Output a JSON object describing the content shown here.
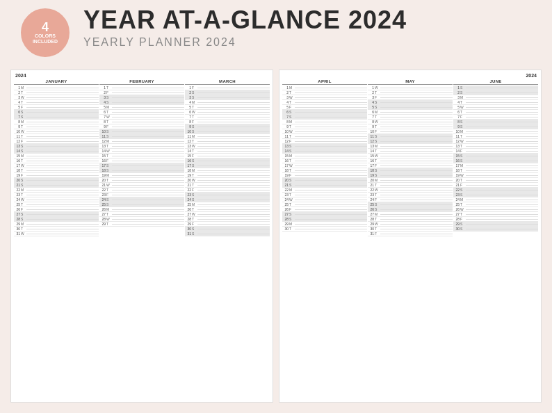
{
  "badge": {
    "number": "4",
    "line1": "COLORS",
    "line2": "INCLUDED"
  },
  "title": {
    "main": "YEAR AT-A-GLANCE 2024",
    "sub": "YEARLY PLANNER 2024"
  },
  "planners": [
    {
      "year": "2024",
      "year_right": "",
      "months": [
        {
          "name": "JANUARY",
          "days": [
            {
              "n": 1,
              "d": "M"
            },
            {
              "n": 2,
              "d": "T"
            },
            {
              "n": 3,
              "d": "W"
            },
            {
              "n": 4,
              "d": "T"
            },
            {
              "n": 5,
              "d": "F"
            },
            {
              "n": 6,
              "d": "S"
            },
            {
              "n": 7,
              "d": "S"
            },
            {
              "n": 8,
              "d": "M"
            },
            {
              "n": 9,
              "d": "T"
            },
            {
              "n": 10,
              "d": "W"
            },
            {
              "n": 11,
              "d": "T"
            },
            {
              "n": 12,
              "d": "F"
            },
            {
              "n": 13,
              "d": "S"
            },
            {
              "n": 14,
              "d": "S"
            },
            {
              "n": 15,
              "d": "M"
            },
            {
              "n": 16,
              "d": "T"
            },
            {
              "n": 17,
              "d": "W"
            },
            {
              "n": 18,
              "d": "T"
            },
            {
              "n": 19,
              "d": "F"
            },
            {
              "n": 20,
              "d": "S"
            },
            {
              "n": 21,
              "d": "S"
            },
            {
              "n": 22,
              "d": "M"
            },
            {
              "n": 23,
              "d": "T"
            },
            {
              "n": 24,
              "d": "W"
            },
            {
              "n": 25,
              "d": "T"
            },
            {
              "n": 26,
              "d": "F"
            },
            {
              "n": 27,
              "d": "S"
            },
            {
              "n": 28,
              "d": "S"
            },
            {
              "n": 29,
              "d": "M"
            },
            {
              "n": 30,
              "d": "T"
            },
            {
              "n": 31,
              "d": "W"
            }
          ]
        },
        {
          "name": "FEBRUARY",
          "days": [
            {
              "n": 1,
              "d": "T"
            },
            {
              "n": 2,
              "d": "F"
            },
            {
              "n": 3,
              "d": "S"
            },
            {
              "n": 4,
              "d": "S"
            },
            {
              "n": 5,
              "d": "M"
            },
            {
              "n": 6,
              "d": "T"
            },
            {
              "n": 7,
              "d": "W"
            },
            {
              "n": 8,
              "d": "T"
            },
            {
              "n": 9,
              "d": "F"
            },
            {
              "n": 10,
              "d": "S"
            },
            {
              "n": 11,
              "d": "S"
            },
            {
              "n": 12,
              "d": "M"
            },
            {
              "n": 13,
              "d": "T"
            },
            {
              "n": 14,
              "d": "W"
            },
            {
              "n": 15,
              "d": "T"
            },
            {
              "n": 16,
              "d": "F"
            },
            {
              "n": 17,
              "d": "S"
            },
            {
              "n": 18,
              "d": "S"
            },
            {
              "n": 19,
              "d": "M"
            },
            {
              "n": 20,
              "d": "T"
            },
            {
              "n": 21,
              "d": "W"
            },
            {
              "n": 22,
              "d": "T"
            },
            {
              "n": 23,
              "d": "F"
            },
            {
              "n": 24,
              "d": "S"
            },
            {
              "n": 25,
              "d": "S"
            },
            {
              "n": 26,
              "d": "M"
            },
            {
              "n": 27,
              "d": "T"
            },
            {
              "n": 28,
              "d": "W"
            },
            {
              "n": 29,
              "d": "T"
            }
          ]
        },
        {
          "name": "MARCH",
          "days": [
            {
              "n": 1,
              "d": "F"
            },
            {
              "n": 2,
              "d": "S"
            },
            {
              "n": 3,
              "d": "S"
            },
            {
              "n": 4,
              "d": "M"
            },
            {
              "n": 5,
              "d": "T"
            },
            {
              "n": 6,
              "d": "W"
            },
            {
              "n": 7,
              "d": "T"
            },
            {
              "n": 8,
              "d": "F"
            },
            {
              "n": 9,
              "d": "S"
            },
            {
              "n": 10,
              "d": "S"
            },
            {
              "n": 11,
              "d": "M"
            },
            {
              "n": 12,
              "d": "T"
            },
            {
              "n": 13,
              "d": "W"
            },
            {
              "n": 14,
              "d": "T"
            },
            {
              "n": 15,
              "d": "F"
            },
            {
              "n": 16,
              "d": "S"
            },
            {
              "n": 17,
              "d": "S"
            },
            {
              "n": 18,
              "d": "M"
            },
            {
              "n": 19,
              "d": "T"
            },
            {
              "n": 20,
              "d": "W"
            },
            {
              "n": 21,
              "d": "T"
            },
            {
              "n": 22,
              "d": "F"
            },
            {
              "n": 23,
              "d": "S"
            },
            {
              "n": 24,
              "d": "S"
            },
            {
              "n": 25,
              "d": "M"
            },
            {
              "n": 26,
              "d": "T"
            },
            {
              "n": 27,
              "d": "W"
            },
            {
              "n": 28,
              "d": "T"
            },
            {
              "n": 29,
              "d": "F"
            },
            {
              "n": 30,
              "d": "S"
            },
            {
              "n": 31,
              "d": "S"
            }
          ]
        }
      ]
    },
    {
      "year": "",
      "year_right": "2024",
      "months": [
        {
          "name": "APRIL",
          "days": [
            {
              "n": 1,
              "d": "M"
            },
            {
              "n": 2,
              "d": "T"
            },
            {
              "n": 3,
              "d": "W"
            },
            {
              "n": 4,
              "d": "T"
            },
            {
              "n": 5,
              "d": "F"
            },
            {
              "n": 6,
              "d": "S"
            },
            {
              "n": 7,
              "d": "S"
            },
            {
              "n": 8,
              "d": "M"
            },
            {
              "n": 9,
              "d": "T"
            },
            {
              "n": 10,
              "d": "W"
            },
            {
              "n": 11,
              "d": "T"
            },
            {
              "n": 12,
              "d": "F"
            },
            {
              "n": 13,
              "d": "S"
            },
            {
              "n": 14,
              "d": "S"
            },
            {
              "n": 15,
              "d": "M"
            },
            {
              "n": 16,
              "d": "T"
            },
            {
              "n": 17,
              "d": "W"
            },
            {
              "n": 18,
              "d": "T"
            },
            {
              "n": 19,
              "d": "F"
            },
            {
              "n": 20,
              "d": "S"
            },
            {
              "n": 21,
              "d": "S"
            },
            {
              "n": 22,
              "d": "M"
            },
            {
              "n": 23,
              "d": "T"
            },
            {
              "n": 24,
              "d": "W"
            },
            {
              "n": 25,
              "d": "T"
            },
            {
              "n": 26,
              "d": "F"
            },
            {
              "n": 27,
              "d": "S"
            },
            {
              "n": 28,
              "d": "S"
            },
            {
              "n": 29,
              "d": "M"
            },
            {
              "n": 30,
              "d": "T"
            }
          ]
        },
        {
          "name": "MAY",
          "days": [
            {
              "n": 1,
              "d": "W"
            },
            {
              "n": 2,
              "d": "T"
            },
            {
              "n": 3,
              "d": "F"
            },
            {
              "n": 4,
              "d": "S"
            },
            {
              "n": 5,
              "d": "S"
            },
            {
              "n": 6,
              "d": "M"
            },
            {
              "n": 7,
              "d": "T"
            },
            {
              "n": 8,
              "d": "W"
            },
            {
              "n": 9,
              "d": "T"
            },
            {
              "n": 10,
              "d": "F"
            },
            {
              "n": 11,
              "d": "S"
            },
            {
              "n": 12,
              "d": "S"
            },
            {
              "n": 13,
              "d": "M"
            },
            {
              "n": 14,
              "d": "T"
            },
            {
              "n": 15,
              "d": "W"
            },
            {
              "n": 16,
              "d": "T"
            },
            {
              "n": 17,
              "d": "F"
            },
            {
              "n": 18,
              "d": "S"
            },
            {
              "n": 19,
              "d": "S"
            },
            {
              "n": 20,
              "d": "M"
            },
            {
              "n": 21,
              "d": "T"
            },
            {
              "n": 22,
              "d": "W"
            },
            {
              "n": 23,
              "d": "T"
            },
            {
              "n": 24,
              "d": "F"
            },
            {
              "n": 25,
              "d": "S"
            },
            {
              "n": 26,
              "d": "S"
            },
            {
              "n": 27,
              "d": "M"
            },
            {
              "n": 28,
              "d": "T"
            },
            {
              "n": 29,
              "d": "W"
            },
            {
              "n": 30,
              "d": "T"
            },
            {
              "n": 31,
              "d": "F"
            }
          ]
        },
        {
          "name": "JUNE",
          "days": [
            {
              "n": 1,
              "d": "S"
            },
            {
              "n": 2,
              "d": "S"
            },
            {
              "n": 3,
              "d": "M"
            },
            {
              "n": 4,
              "d": "T"
            },
            {
              "n": 5,
              "d": "W"
            },
            {
              "n": 6,
              "d": "T"
            },
            {
              "n": 7,
              "d": "F"
            },
            {
              "n": 8,
              "d": "S"
            },
            {
              "n": 9,
              "d": "S"
            },
            {
              "n": 10,
              "d": "M"
            },
            {
              "n": 11,
              "d": "T"
            },
            {
              "n": 12,
              "d": "W"
            },
            {
              "n": 13,
              "d": "T"
            },
            {
              "n": 14,
              "d": "F"
            },
            {
              "n": 15,
              "d": "S"
            },
            {
              "n": 16,
              "d": "S"
            },
            {
              "n": 17,
              "d": "M"
            },
            {
              "n": 18,
              "d": "T"
            },
            {
              "n": 19,
              "d": "W"
            },
            {
              "n": 20,
              "d": "T"
            },
            {
              "n": 21,
              "d": "F"
            },
            {
              "n": 22,
              "d": "S"
            },
            {
              "n": 23,
              "d": "S"
            },
            {
              "n": 24,
              "d": "M"
            },
            {
              "n": 25,
              "d": "T"
            },
            {
              "n": 26,
              "d": "W"
            },
            {
              "n": 27,
              "d": "T"
            },
            {
              "n": 28,
              "d": "F"
            },
            {
              "n": 29,
              "d": "S"
            },
            {
              "n": 30,
              "d": "S"
            }
          ]
        }
      ]
    }
  ]
}
